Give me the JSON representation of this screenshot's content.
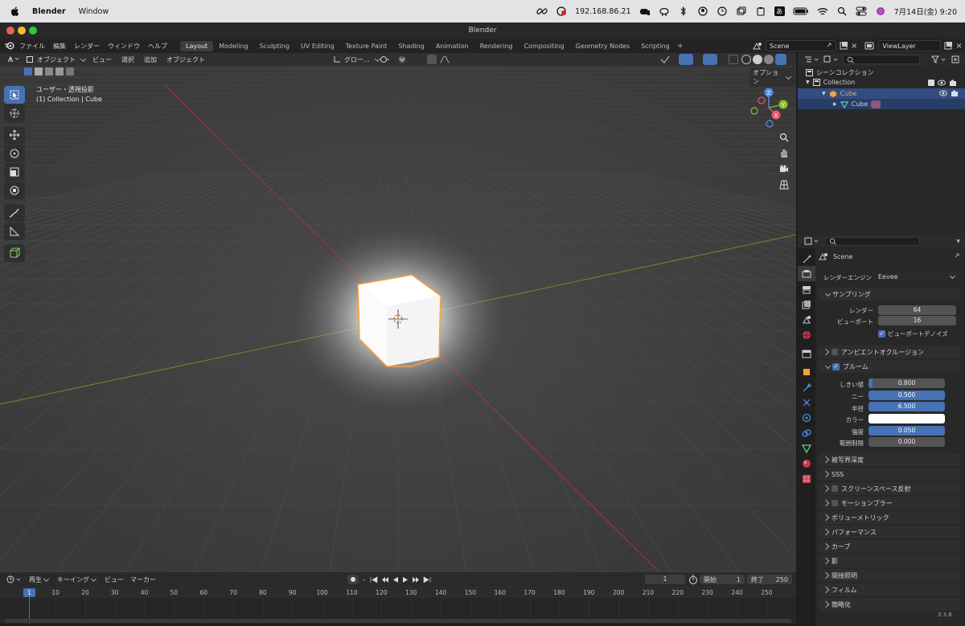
{
  "macbar": {
    "app_name": "Blender",
    "menu_window": "Window",
    "ip": "192.168.86.21",
    "date_time": "7月14日(金)  9:20",
    "ime_label": "あ"
  },
  "window": {
    "title": "Blender"
  },
  "topbar": {
    "menus": [
      "ファイル",
      "編集",
      "レンダー",
      "ウィンドウ",
      "ヘルプ"
    ],
    "workspaces": [
      "Layout",
      "Modeling",
      "Sculpting",
      "UV Editing",
      "Texture Paint",
      "Shading",
      "Animation",
      "Rendering",
      "Compositing",
      "Geometry Nodes",
      "Scripting"
    ],
    "active_workspace": "Layout",
    "add_tab": "+",
    "scene": "Scene",
    "view_layer": "ViewLayer"
  },
  "viewport": {
    "mode": "オブジェクト",
    "menus": [
      "ビュー",
      "選択",
      "追加",
      "オブジェクト"
    ],
    "transform": "グロー...",
    "options": "オプション",
    "overlay_title": "ユーザー・透視投影",
    "overlay_sub": "(1) Collection | Cube",
    "gizmo": {
      "x": "X",
      "y": "Y",
      "z": "Z"
    }
  },
  "outliner": {
    "root": "シーンコレクション",
    "collection": "Collection",
    "object": "Cube",
    "mesh": "Cube"
  },
  "properties": {
    "scene": "Scene",
    "engine_label": "レンダーエンジン",
    "engine_value": "Eevee",
    "sampling": {
      "title": "サンプリング",
      "render_label": "レンダー",
      "render_value": "64",
      "viewport_label": "ビューポート",
      "viewport_value": "16",
      "denoise_label": "ビューポートデノイズ"
    },
    "ao": "アンビエントオクルージョン",
    "bloom": {
      "title": "ブルーム",
      "threshold_label": "しきい値",
      "threshold_value": "0.800",
      "knee_label": "ニー",
      "knee_value": "0.500",
      "radius_label": "半径",
      "radius_value": "6.500",
      "color_label": "カラー",
      "intensity_label": "強度",
      "intensity_value": "0.050",
      "clamp_label": "範囲制限",
      "clamp_value": "0.000"
    },
    "sections": [
      "被写界深度",
      "SSS",
      "スクリーンスペース反射",
      "モーションブラー",
      "ボリューメトリック",
      "パフォーマンス",
      "カーブ",
      "影",
      "間接照明",
      "フィルム",
      "簡略化"
    ],
    "version": "3.3.6"
  },
  "timeline": {
    "menus": [
      "再生",
      "キーイング",
      "ビュー",
      "マーカー"
    ],
    "current_frame": "1",
    "start_label": "開始",
    "start_value": "1",
    "end_label": "終了",
    "end_value": "250",
    "ticks": [
      "10",
      "20",
      "30",
      "40",
      "50",
      "60",
      "70",
      "80",
      "90",
      "100",
      "110",
      "120",
      "130",
      "140",
      "150",
      "160",
      "170",
      "180",
      "190",
      "200",
      "210",
      "220",
      "230",
      "240",
      "250"
    ],
    "playhead": "1"
  },
  "colors": {
    "accent": "#4772b3",
    "selection_orange": "#f5a23a",
    "x_axis": "#a8323e",
    "y_axis": "#6b8f2a"
  }
}
